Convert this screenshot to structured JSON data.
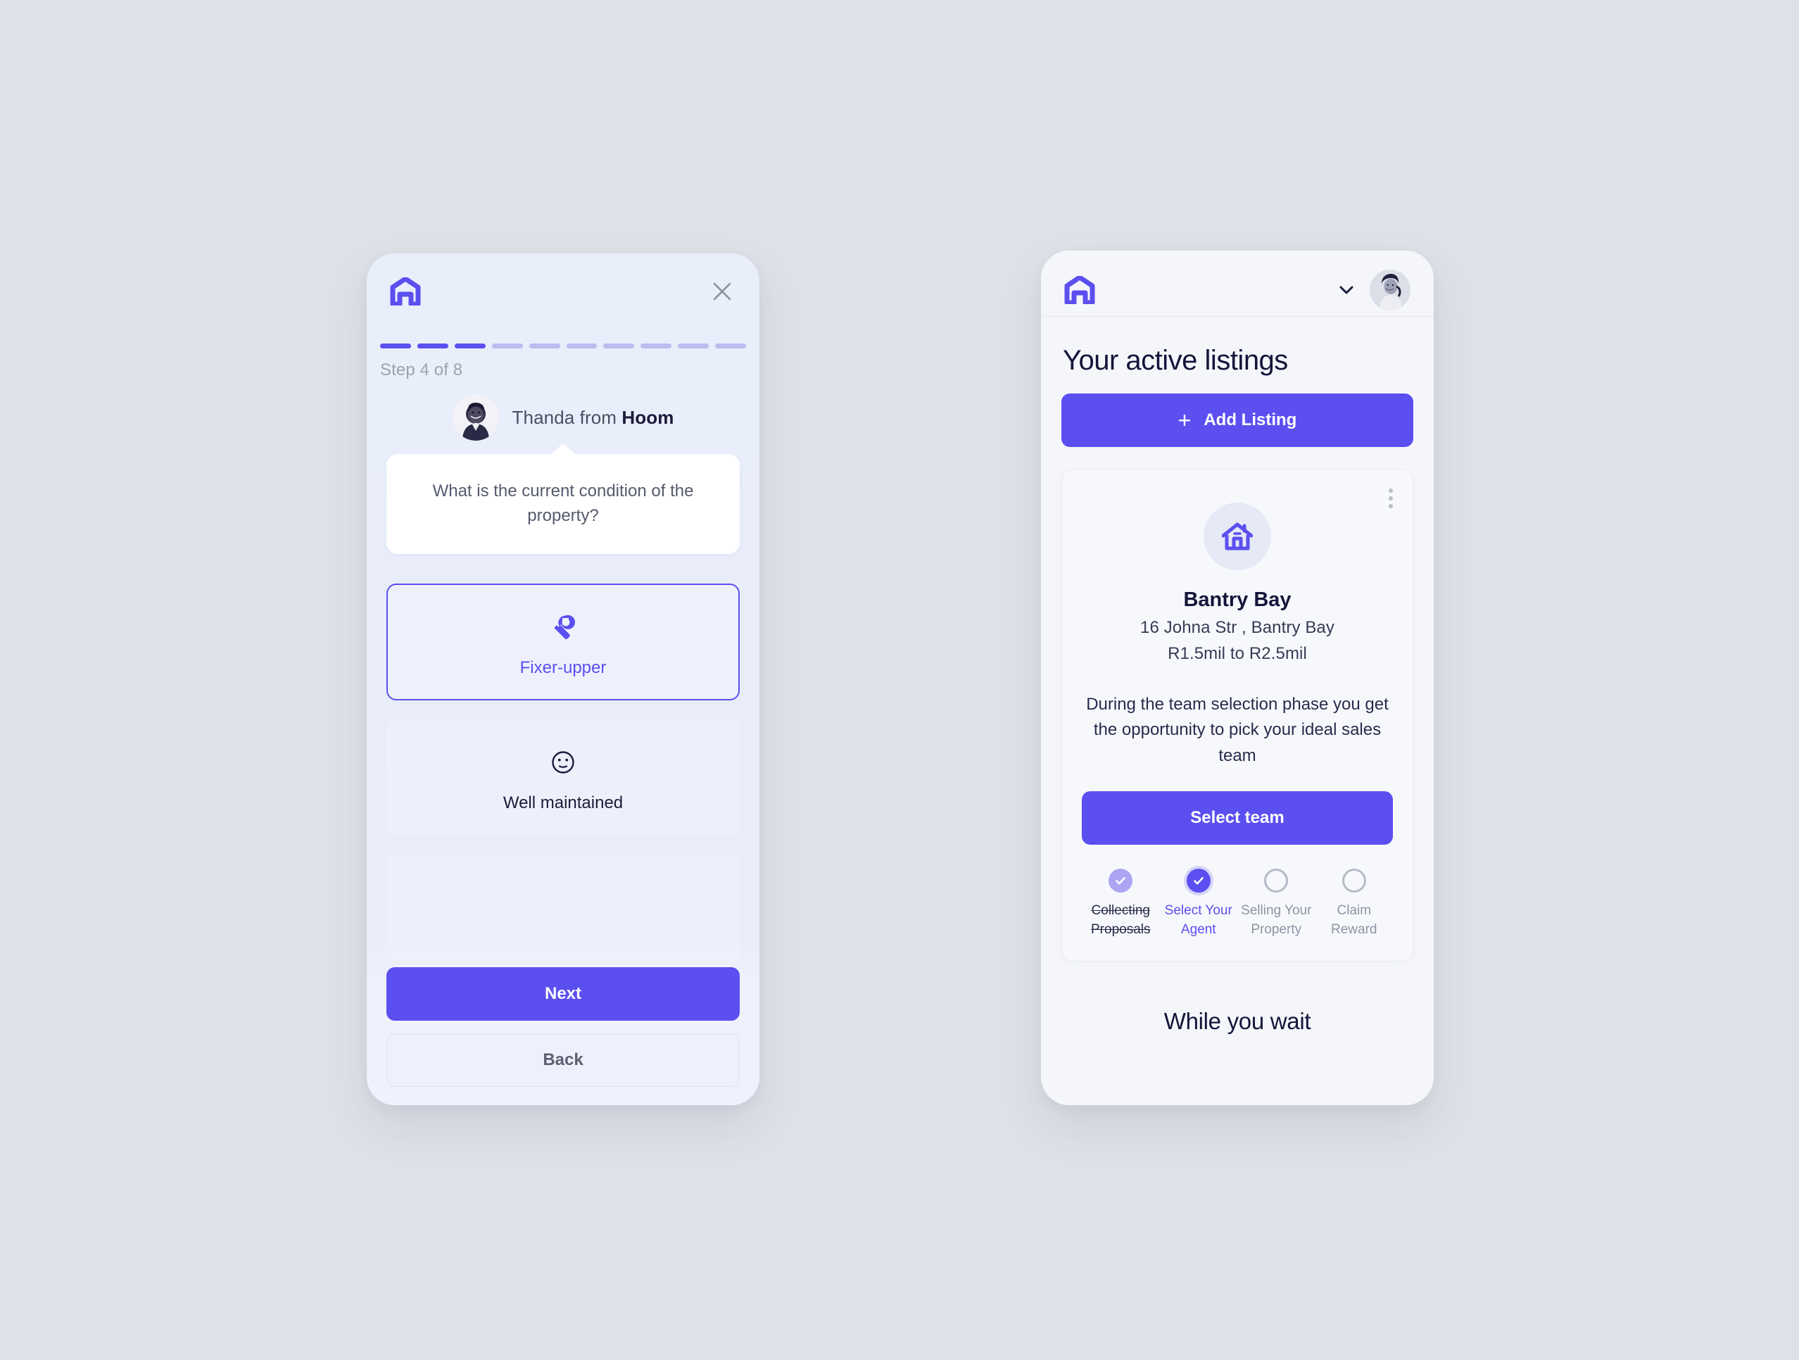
{
  "brand": {
    "name": "Hoom",
    "accent": "#5b4ff0",
    "accent_light": "#b9bdf0",
    "logo_icon": "house-logo-icon"
  },
  "onboarding": {
    "close_icon": "close-icon",
    "progress": {
      "total_segments": 10,
      "completed_segments": 3,
      "step_label": "Step 4 of 8"
    },
    "agent": {
      "avatar_icon": "agent-avatar",
      "prefix": "Thanda from ",
      "company": "Hoom"
    },
    "question": "What is the current condition of the property?",
    "options": [
      {
        "label": "Fixer-upper",
        "icon": "wrench-icon",
        "selected": true
      },
      {
        "label": "Well maintained",
        "icon": "smiley-face-icon",
        "selected": false
      }
    ],
    "buttons": {
      "next": "Next",
      "back": "Back"
    }
  },
  "dashboard": {
    "topbar": {
      "logo_icon": "house-logo-icon",
      "chevron_icon": "chevron-down-icon",
      "avatar_icon": "user-avatar"
    },
    "title": "Your active listings",
    "add_listing": {
      "label": "Add Listing",
      "icon": "plus-icon"
    },
    "listing": {
      "menu_icon": "kebab-menu-icon",
      "thumb_icon": "house-icon",
      "name": "Bantry Bay",
      "address": "16 Johna Str , Bantry Bay",
      "price_range": "R1.5mil to R2.5mil",
      "description": "During the team selection phase you get the opportunity to pick your ideal sales team",
      "cta": "Select  team",
      "stages": [
        {
          "label": "Collecting Proposals",
          "state": "completed",
          "icon": "check-icon"
        },
        {
          "label": "Select Your Agent",
          "state": "current",
          "icon": "check-icon"
        },
        {
          "label": "Selling Your Property",
          "state": "todo",
          "icon": "empty-circle-icon"
        },
        {
          "label": "Claim Reward",
          "state": "todo",
          "icon": "empty-circle-icon"
        }
      ]
    },
    "section_heading": "While you wait"
  }
}
